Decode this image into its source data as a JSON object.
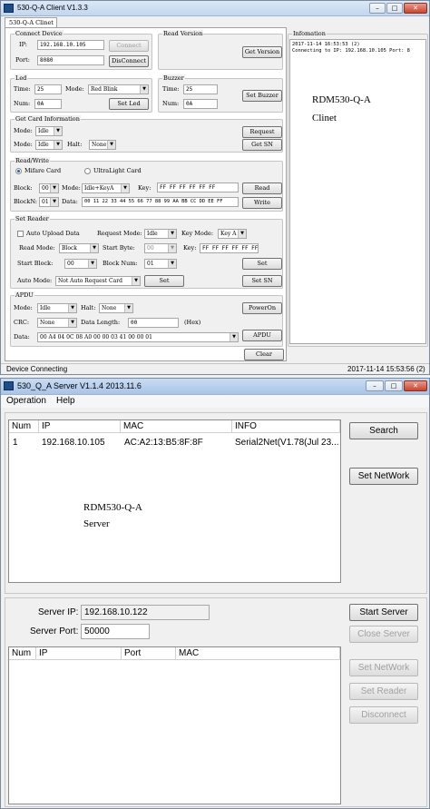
{
  "client": {
    "title": "530-Q-A Client V1.3.3",
    "tab": "530-Q-A Clinet",
    "connect_device": {
      "group": "Connect Device",
      "ip_label": "IP:",
      "ip_value": "192.168.10.105",
      "port_label": "Port:",
      "port_value": "8080",
      "connect_btn": "Connect",
      "disconnect_btn": "DisConnect"
    },
    "read_version": {
      "group": "Read Version",
      "button": "Get Version"
    },
    "led": {
      "group": "Led",
      "time_label": "Time:",
      "time_value": "25",
      "mode_label": "Mode:",
      "mode_value": "Red Blink",
      "num_label": "Num:",
      "num_value": "0A",
      "button": "Set Led"
    },
    "buzzer": {
      "group": "Buzzer",
      "time_label": "Time:",
      "time_value": "25",
      "num_label": "Num:",
      "num_value": "0A",
      "button": "Set Buzzer"
    },
    "get_card": {
      "group": "Get Card Information",
      "mode_label": "Mode:",
      "mode1_value": "Idle",
      "mode2_value": "Idle",
      "halt_label": "Halt:",
      "halt_value": "None",
      "request_btn": "Request",
      "getsn_btn": "Get SN"
    },
    "read_write": {
      "group": "Read/Write",
      "mifare": "Mifare Card",
      "ultralight": "UltraLight Card",
      "block_label": "Block:",
      "block_value": "00",
      "mode_label": "Mode:",
      "mode_value": "Idle+KeyA",
      "key_label": "Key:",
      "key_value": "FF FF FF FF FF FF",
      "read_btn": "Read",
      "blockn_label": "BlockN:",
      "blockn_value": "01",
      "data_label": "Data:",
      "data_value": "00 11 22 33 44 55 66 77 88 99 AA BB CC DD EE FF",
      "write_btn": "Write"
    },
    "set_reader": {
      "group": "Set Reader",
      "auto_upload": "Auto Upload Data",
      "request_mode_label": "Request Mode:",
      "request_mode_value": "Idle",
      "key_mode_label": "Key Mode:",
      "key_mode_value": "Key A",
      "read_mode_label": "Read Mode:",
      "read_mode_value": "Block",
      "start_byte_label": "Start Byte:",
      "start_byte_value": "00",
      "key_label": "Key:",
      "key_value": "FF FF FF FF FF FF",
      "start_block_label": "Start Block:",
      "start_block_value": "00",
      "block_num_label": "Block Num:",
      "block_num_value": "01",
      "set_btn": "Set",
      "auto_mode_label": "Auto Mode:",
      "auto_mode_value": "Not Auto Request Card",
      "set2_btn": "Set",
      "setsn_btn": "Set SN"
    },
    "apdu": {
      "group": "APDU",
      "mode_label": "Mode:",
      "mode_value": "Idle",
      "halt_label": "Halt:",
      "halt_value": "None",
      "poweron_btn": "PowerOn",
      "crc_label": "CRC:",
      "crc_value": "None",
      "data_length_label": "Data Length:",
      "data_length_value": "00",
      "hex": "(Hex)",
      "apdu_btn": "APDU",
      "data_label": "Data:",
      "data_value": "00 A4 04 0C 08 A0 00 00 03 41 00 00 01"
    },
    "info": {
      "group": "Infomation",
      "lines": [
        "2017-11-14 16:53:53 (2)",
        "Connecting to IP: 192.168.10.105 Port: 8"
      ],
      "watermark1": "RDM530-Q-A",
      "watermark2": "Clinet"
    },
    "clear_btn": "Clear",
    "status_left": "Device Connecting",
    "status_right": "2017-11-14  15:53:56 (2)"
  },
  "server": {
    "title": "530_Q_A Server V1.1.4 2013.11.6",
    "menu": [
      "Operation",
      "Help"
    ],
    "devices": {
      "columns": [
        "Num",
        "IP",
        "MAC",
        "INFO"
      ],
      "rows": [
        [
          "1",
          "192.168.10.105",
          "AC:A2:13:B5:8F:8F",
          "Serial2Net(V1.78(Jul 23..."
        ]
      ]
    },
    "watermark1": "RDM530-Q-A",
    "watermark2": "Server",
    "search_btn": "Search",
    "set_network_btn": "Set NetWork",
    "server_ip_label": "Server IP:",
    "server_ip_value": "192.168.10.122",
    "server_port_label": "Server Port:",
    "server_port_value": "50000",
    "clients": {
      "columns": [
        "Num",
        "IP",
        "Port",
        "MAC"
      ]
    },
    "start_server_btn": "Start Server",
    "close_server_btn": "Close Server",
    "set_network2_btn": "Set NetWork",
    "set_reader_btn": "Set Reader",
    "disconnect_btn": "Disconnect"
  }
}
